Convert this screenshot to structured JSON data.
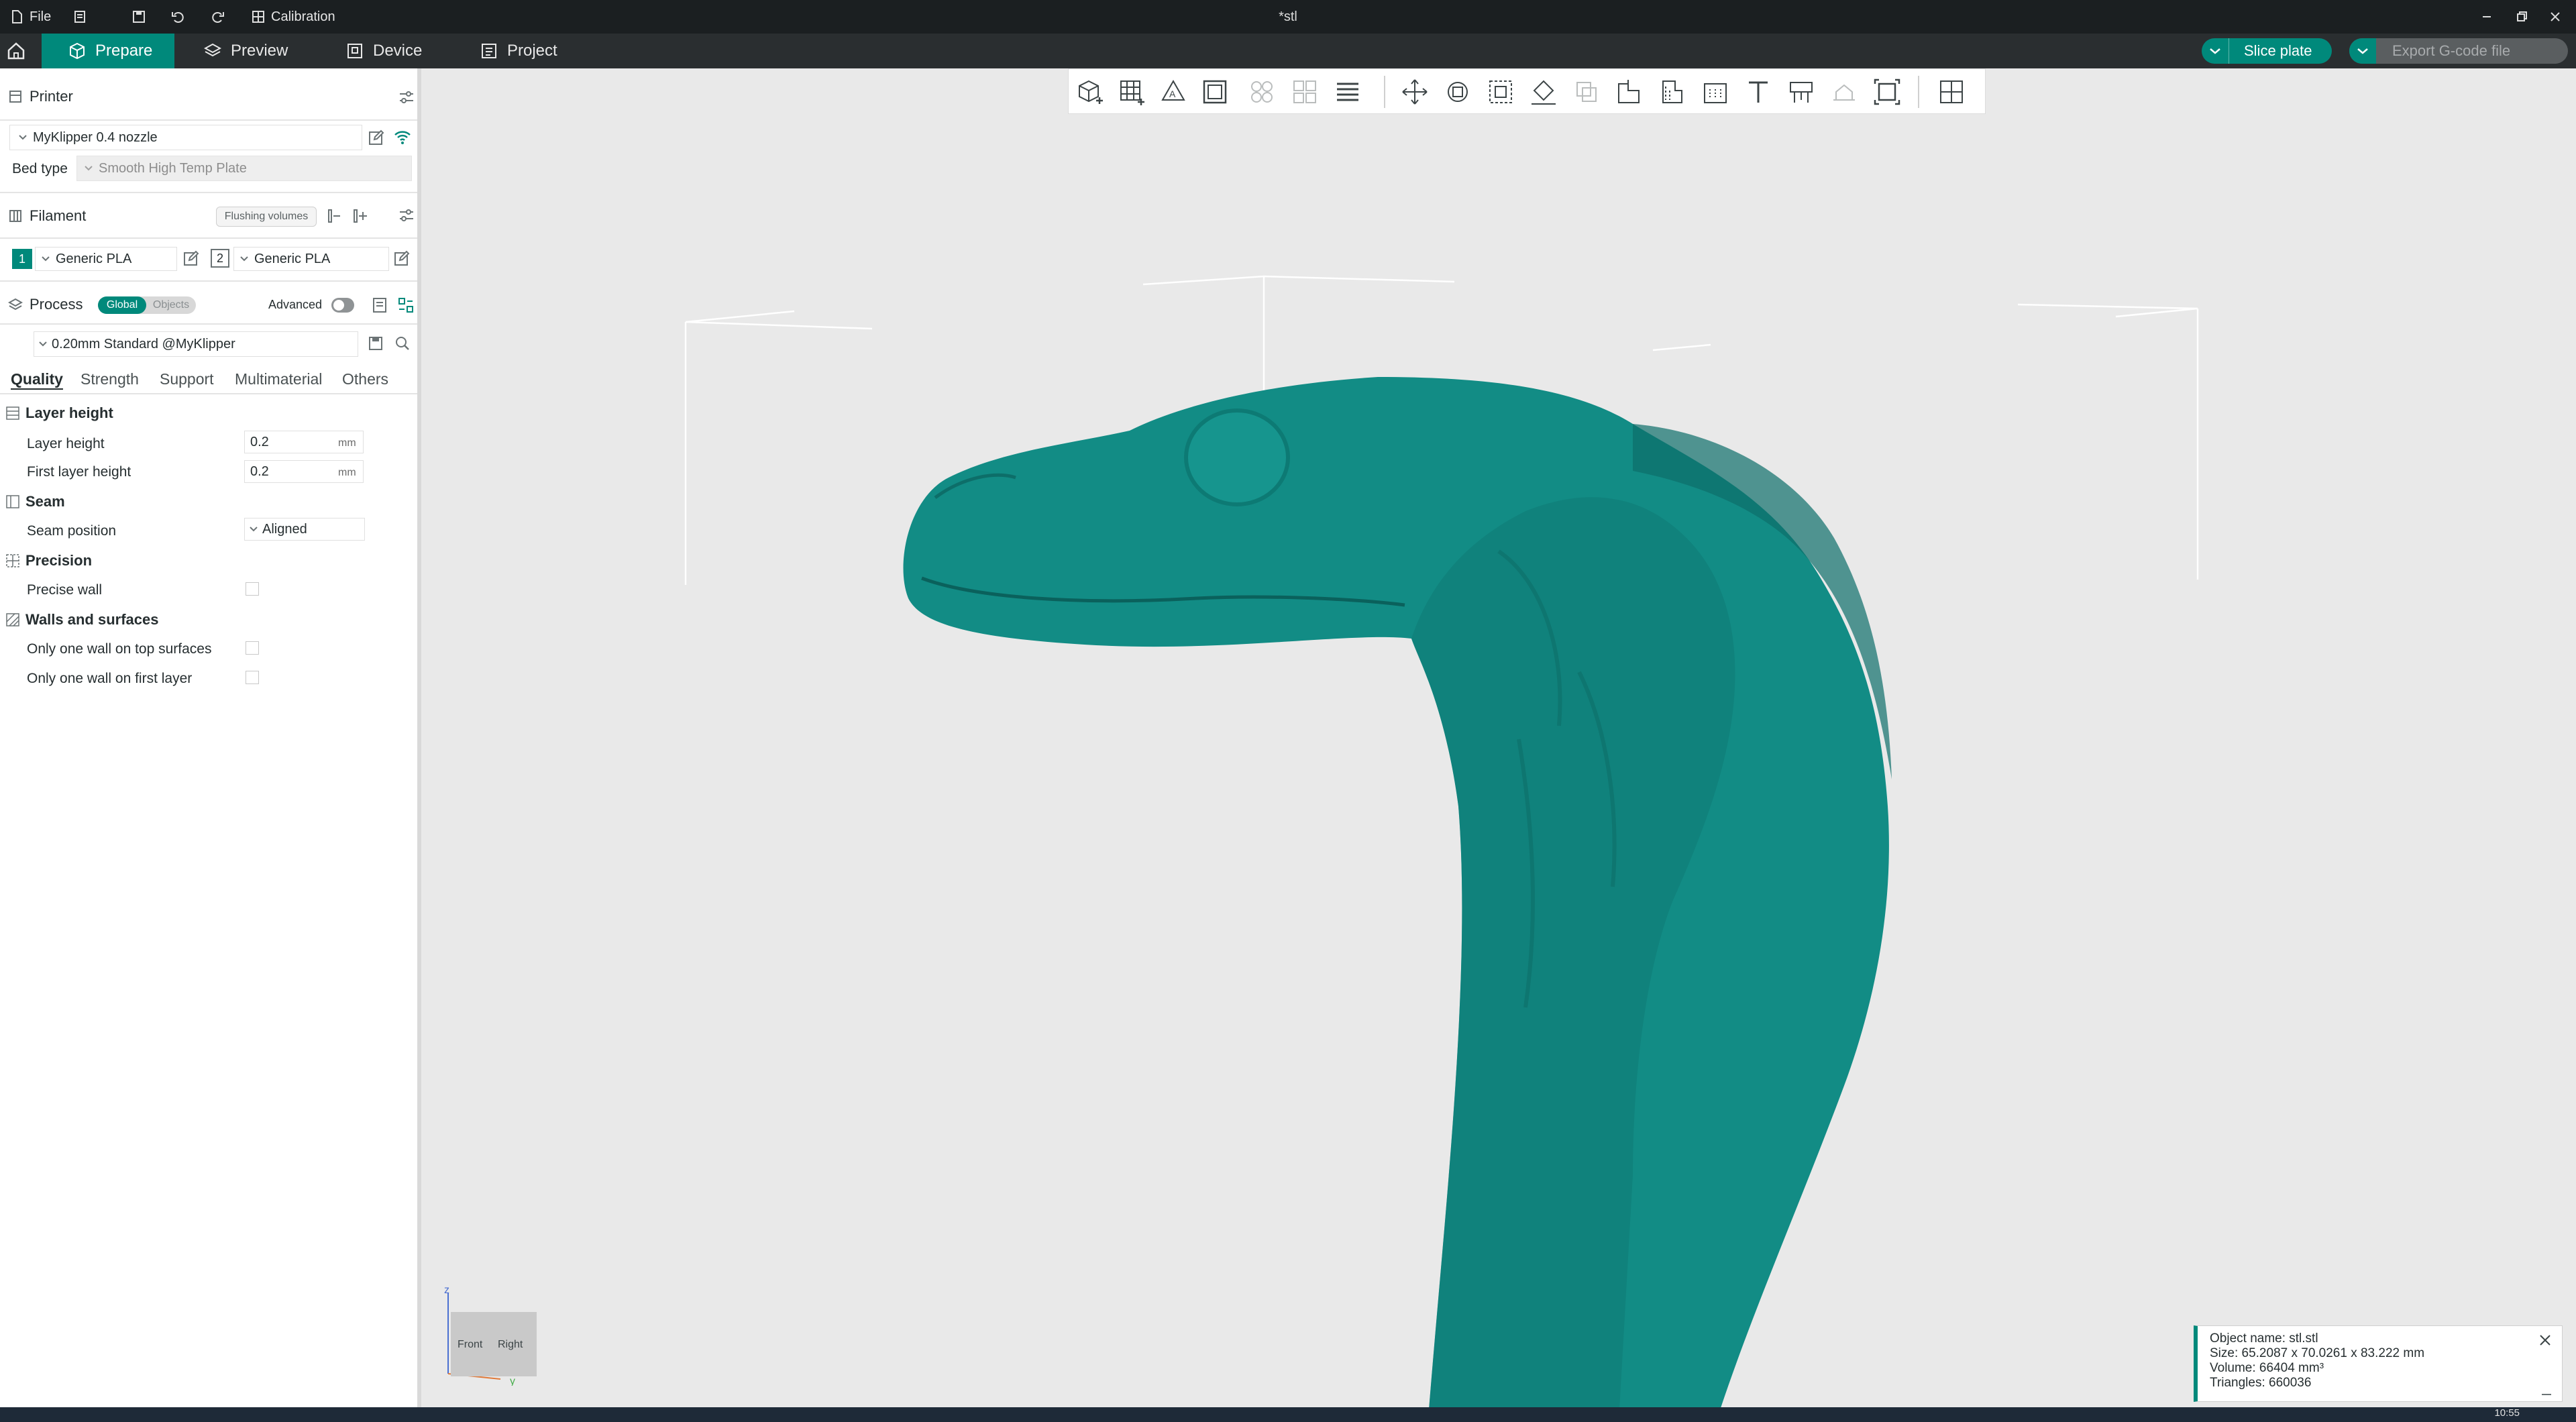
{
  "titlebar": {
    "file_label": "File",
    "calibration_label": "Calibration",
    "document_title": "*stl"
  },
  "tabs": [
    {
      "label": "Prepare",
      "active": true
    },
    {
      "label": "Preview",
      "active": false
    },
    {
      "label": "Device",
      "active": false
    },
    {
      "label": "Project",
      "active": false
    }
  ],
  "actions": {
    "slice_label": "Slice plate",
    "export_label": "Export G-code file"
  },
  "printer": {
    "section_title": "Printer",
    "selected": "MyKlipper 0.4 nozzle",
    "bed_type_label": "Bed type",
    "bed_type_value": "Smooth High Temp Plate"
  },
  "filament": {
    "section_title": "Filament",
    "flushing_label": "Flushing volumes",
    "slots": [
      {
        "index": "1",
        "name": "Generic PLA"
      },
      {
        "index": "2",
        "name": "Generic PLA"
      }
    ]
  },
  "process": {
    "section_title": "Process",
    "toggle_global": "Global",
    "toggle_objects": "Objects",
    "advanced_label": "Advanced",
    "preset": "0.20mm Standard @MyKlipper",
    "subtabs": [
      "Quality",
      "Strength",
      "Support",
      "Multimaterial",
      "Others"
    ],
    "groups": {
      "layer_height": "Layer height",
      "seam": "Seam",
      "precision": "Precision",
      "walls": "Walls and surfaces"
    },
    "settings": {
      "layer_height_label": "Layer height",
      "layer_height_value": "0.2",
      "first_layer_label": "First layer height",
      "first_layer_value": "0.2",
      "unit": "mm",
      "seam_position_label": "Seam position",
      "seam_position_value": "Aligned",
      "precise_wall_label": "Precise wall",
      "one_wall_top_label": "Only one wall on top surfaces",
      "one_wall_first_label": "Only one wall on first layer"
    }
  },
  "view_axes": {
    "z": "z",
    "y": "y",
    "front": "Front",
    "right": "Right"
  },
  "object_info": {
    "name": "Object name: stl.stl",
    "size": "Size: 65.2087 x 70.0261 x 83.222 mm",
    "volume": "Volume: 66404 mm³",
    "triangles": "Triangles: 660036"
  },
  "clock": "10:55",
  "colors": {
    "accent": "#00897b",
    "model": "#128c85"
  }
}
